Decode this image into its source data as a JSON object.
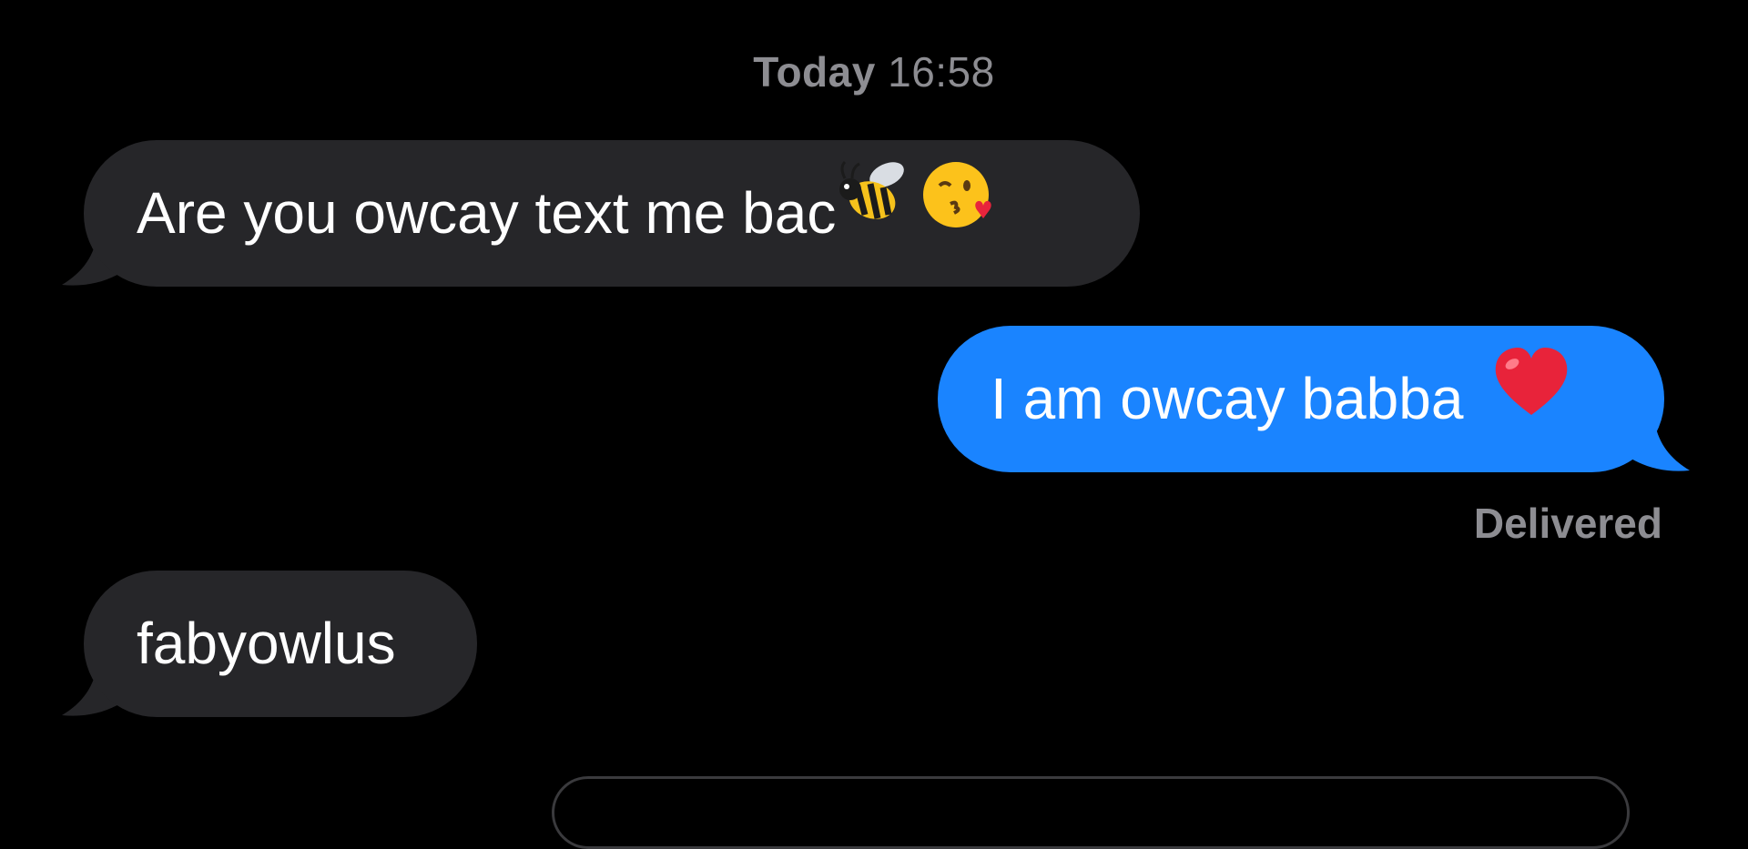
{
  "header": {
    "timestamp_day": "Today",
    "timestamp_time": "16:58"
  },
  "messages": [
    {
      "direction": "incoming",
      "text": "Are you owcay text me bac",
      "emoji": [
        "bee-icon",
        "face-blowing-kiss-icon"
      ]
    },
    {
      "direction": "outgoing",
      "text": "I am owcay babba",
      "emoji": [
        "red-heart-icon"
      ]
    },
    {
      "direction": "incoming",
      "text": "fabyowlus"
    }
  ],
  "status": {
    "delivered_label": "Delivered"
  },
  "colors": {
    "background": "#000000",
    "incoming_bubble": "#262629",
    "outgoing_bubble": "#1a84ff",
    "meta_text": "#8d8d92"
  }
}
